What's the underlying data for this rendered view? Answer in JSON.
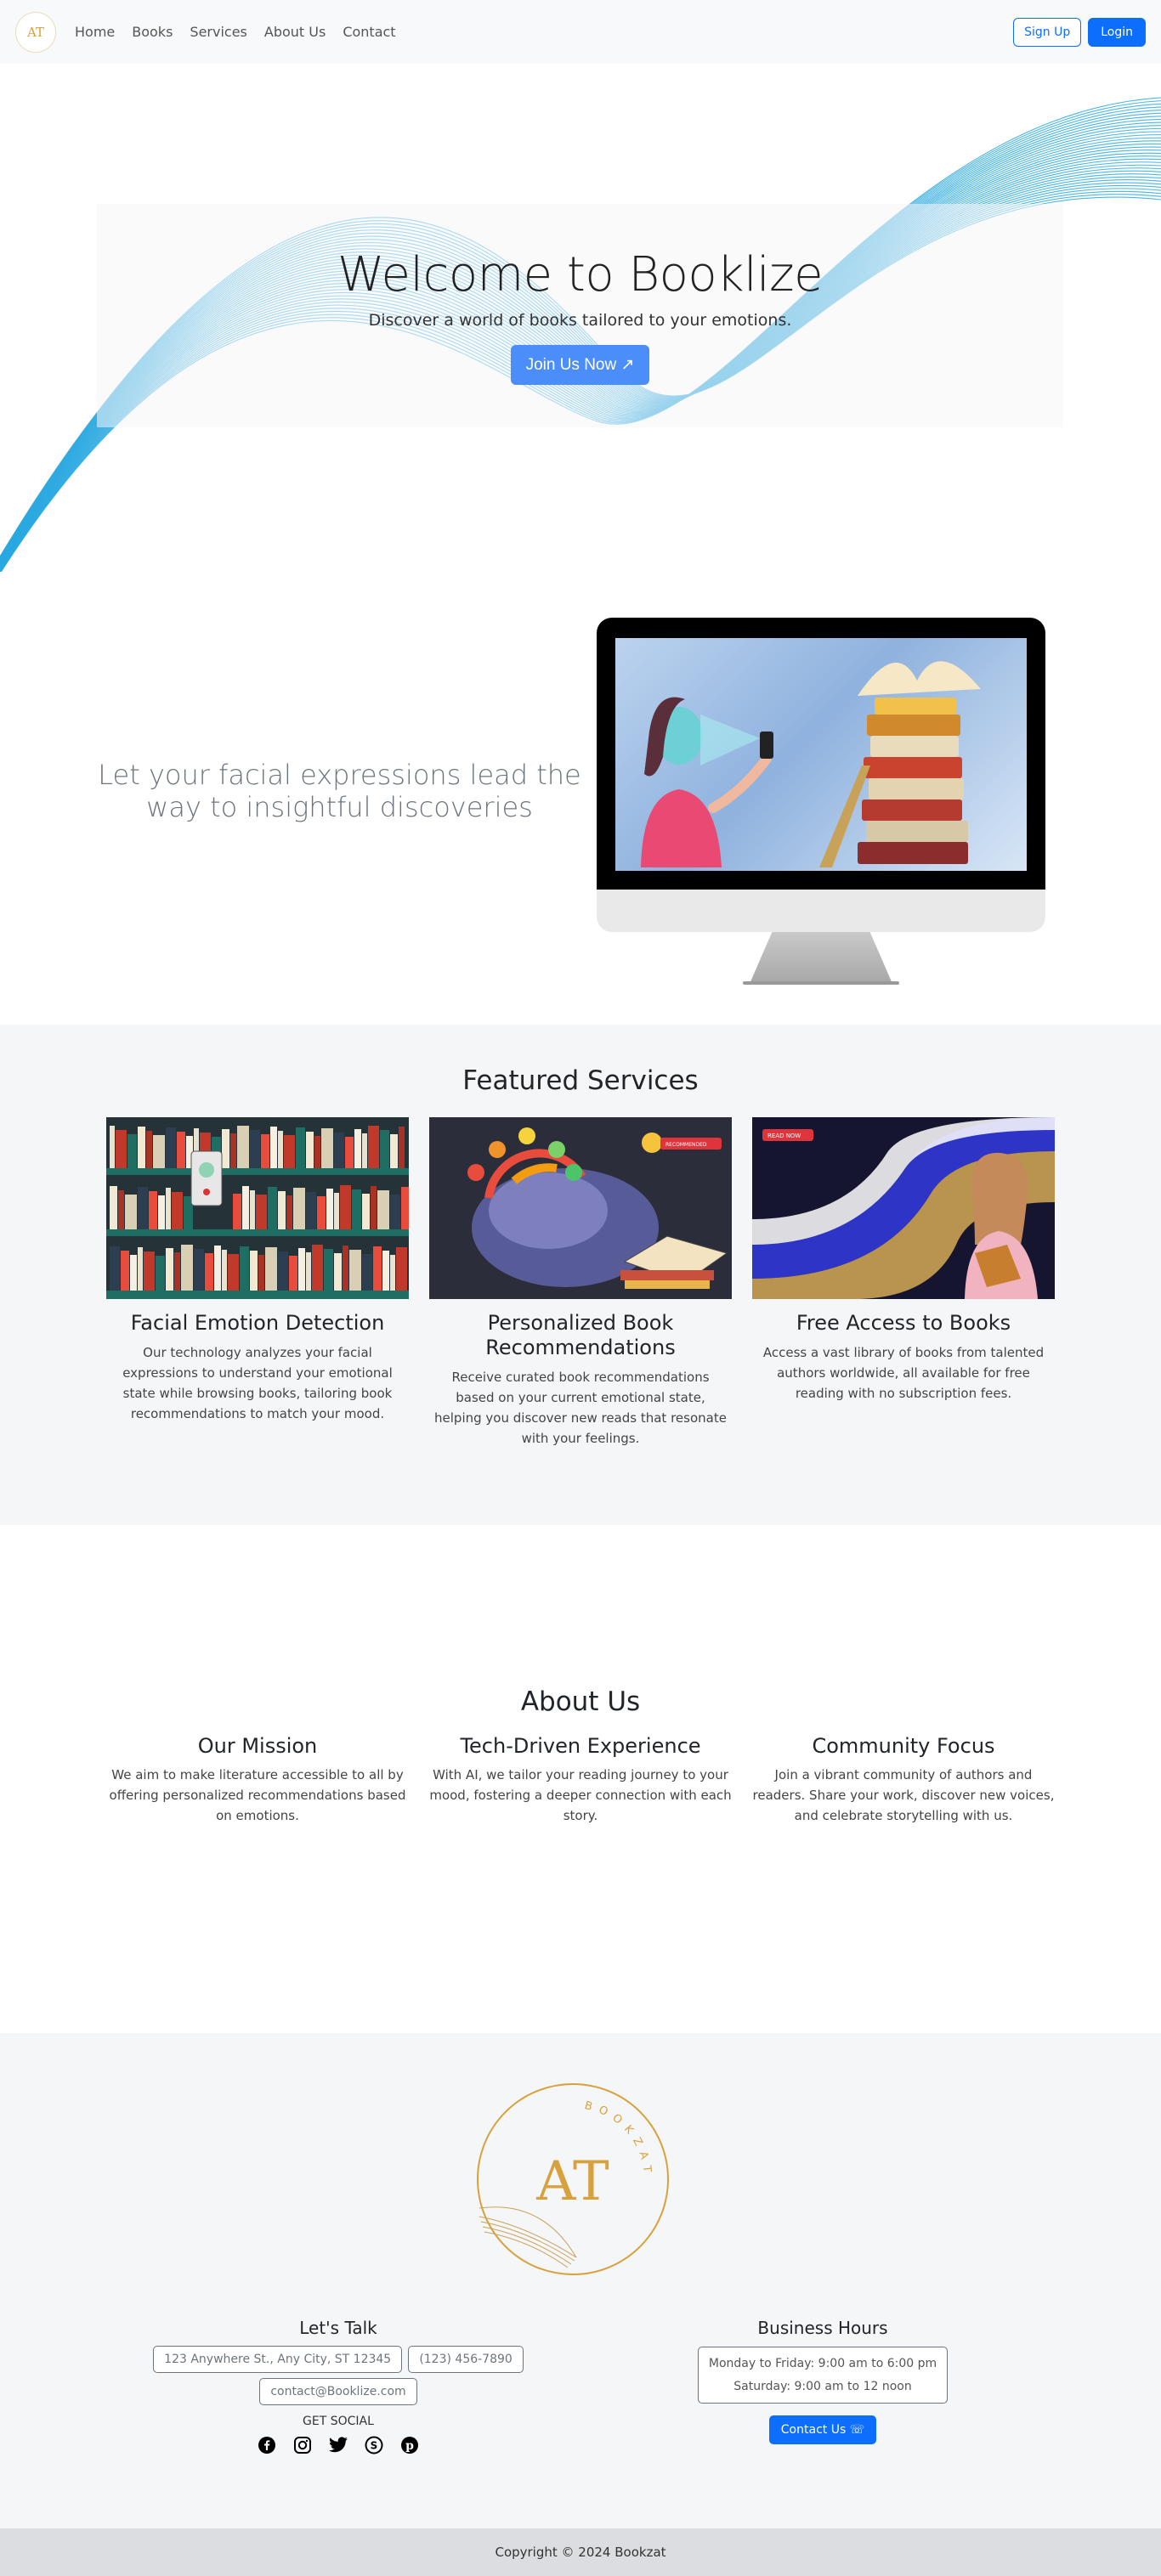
{
  "nav": {
    "logo_text": "AT",
    "links": [
      "Home",
      "Books",
      "Services",
      "About Us",
      "Contact"
    ],
    "signup_label": "Sign Up",
    "login_label": "Login"
  },
  "hero": {
    "title": "Welcome to Booklize",
    "subtitle": "Discover a world of books tailored to your emotions.",
    "cta_label": "Join Us Now ↗"
  },
  "face": {
    "heading": "Let your facial expressions lead the way to insightful discoveries"
  },
  "featured": {
    "heading": "Featured Services",
    "cards": [
      {
        "title": "Facial Emotion Detection",
        "text": "Our technology analyzes your facial expressions to understand your emotional state while browsing books, tailoring book recommendations to match your mood.",
        "badge": ""
      },
      {
        "title": "Personalized Book Recommendations",
        "text": "Receive curated book recommendations based on your current emotional state, helping you discover new reads that resonate with your feelings.",
        "badge": "RECOMMENDED"
      },
      {
        "title": "Free Access to Books",
        "text": "Access a vast library of books from talented authors worldwide, all available for free reading with no subscription fees.",
        "badge": "READ NOW"
      }
    ]
  },
  "about": {
    "heading": "About Us",
    "cols": [
      {
        "title": "Our Mission",
        "text": "We aim to make literature accessible to all by offering personalized recommendations based on emotions."
      },
      {
        "title": "Tech-Driven Experience",
        "text": "With AI, we tailor your reading journey to your mood, fostering a deeper connection with each story."
      },
      {
        "title": "Community Focus",
        "text": "Join a vibrant community of authors and readers. Share your work, discover new voices, and celebrate storytelling with us."
      }
    ]
  },
  "footer": {
    "brand_ring_text": "BOOKZAT",
    "brand_monogram": "AT",
    "talk_heading": "Let's Talk",
    "address": "123 Anywhere St., Any City, ST 12345",
    "phone": "(123) 456-7890",
    "email": "contact@Booklize.com",
    "social_label": "GET SOCIAL",
    "social_icons": [
      "facebook-icon",
      "instagram-icon",
      "twitter-icon",
      "skype-icon",
      "pinterest-icon"
    ],
    "hours_heading": "Business Hours",
    "weekday_hours": "Monday to Friday: 9:00 am to 6:00 pm",
    "saturday_hours": "Saturday: 9:00 am to 12 noon",
    "contact_label": "Contact Us ☏"
  },
  "copyright": "Copyright © 2024 Bookzat",
  "colors": {
    "primary": "#0d6efd",
    "wave": "#29a8e0",
    "gold": "#d7a23d",
    "section_bg": "#f5f6f8"
  }
}
